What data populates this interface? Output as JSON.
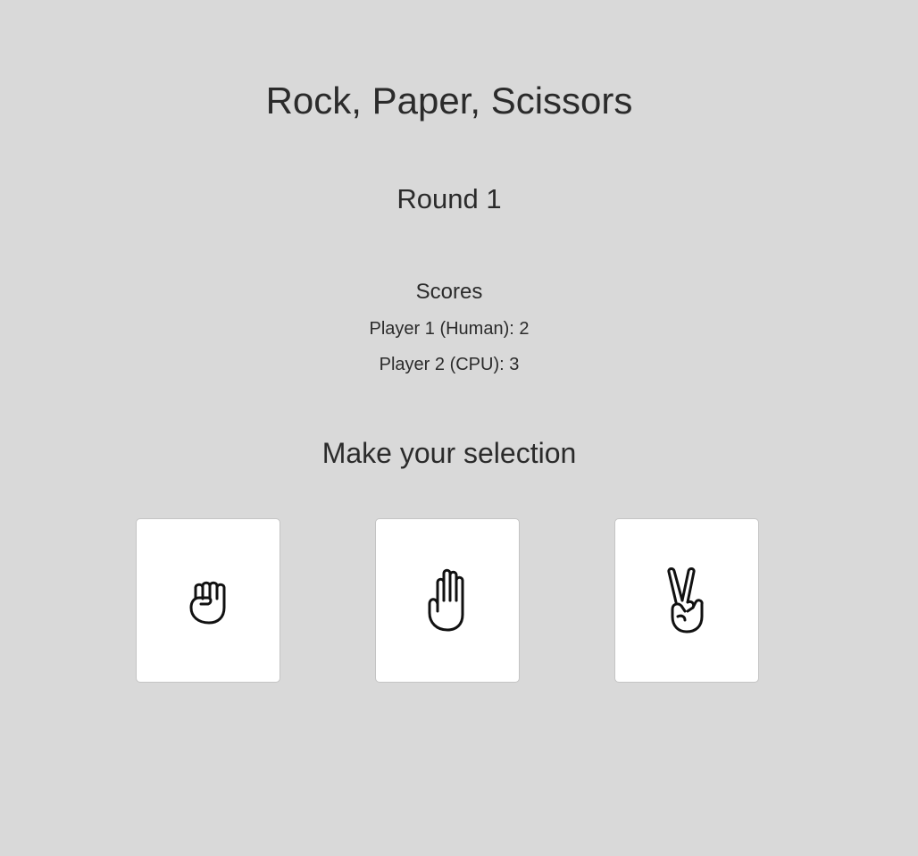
{
  "game": {
    "title": "Rock, Paper, Scissors",
    "round_label": "Round 1"
  },
  "scores": {
    "heading": "Scores",
    "player1": "Player 1 (Human): 2",
    "player2": "Player 2 (CPU): 3"
  },
  "selection": {
    "prompt": "Make your selection",
    "choices": [
      {
        "name": "rock",
        "icon": "fist-icon"
      },
      {
        "name": "paper",
        "icon": "open-hand-icon"
      },
      {
        "name": "scissors",
        "icon": "peace-hand-icon"
      }
    ]
  },
  "colors": {
    "background": "#d9d9d9",
    "card": "#ffffff",
    "text": "#2b2b2b"
  }
}
